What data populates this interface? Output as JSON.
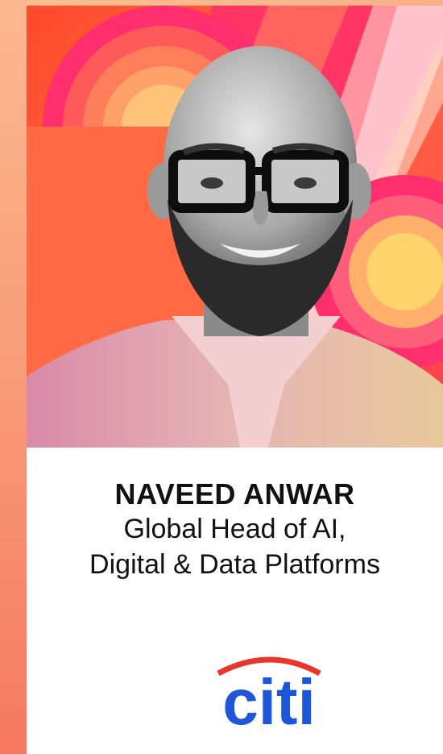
{
  "profile": {
    "name": "NAVEED ANWAR",
    "title_line1": "Global Head of AI,",
    "title_line2": "Digital & Data Platforms"
  },
  "logo": {
    "text": "citi",
    "text_color": "#1e56d9",
    "arc_color": "#e8362a"
  },
  "colors": {
    "side_strip": "#f99f7a",
    "photo_background": "#ff5d3f",
    "accent_pink": "#ff2e6d",
    "accent_yellow": "#ffd36b"
  },
  "icons": {
    "portrait": "person-portrait-icon",
    "logo": "citi-logo-icon"
  }
}
